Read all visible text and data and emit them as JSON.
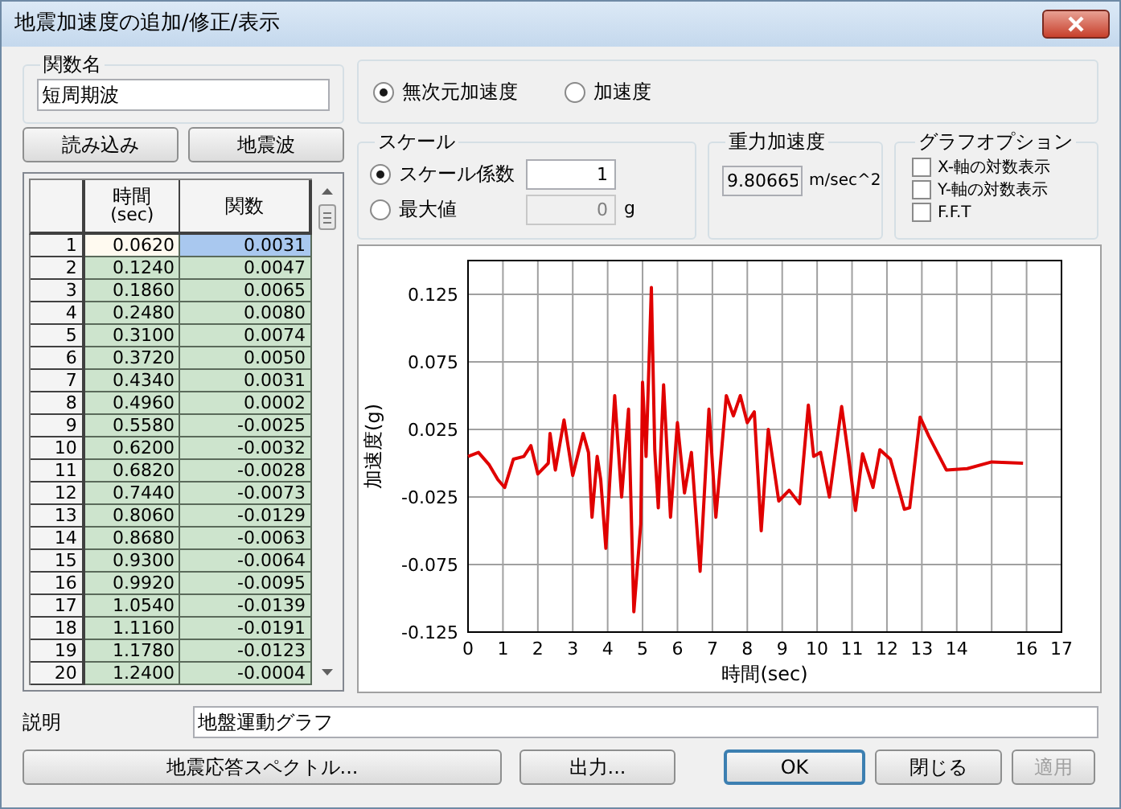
{
  "window": {
    "title": "地震加速度の追加/修正/表示"
  },
  "function_name": {
    "label": "関数名",
    "value": "短周期波"
  },
  "mode_options": [
    {
      "label": "無次元加速度",
      "selected": true
    },
    {
      "label": "加速度",
      "selected": false
    }
  ],
  "load_buttons": [
    "読み込み",
    "地震波"
  ],
  "table": {
    "columns": [
      {
        "label": "時間",
        "unit": "(sec)"
      },
      {
        "label": "関数"
      }
    ],
    "rows": [
      {
        "number": "1",
        "time": "0.0620",
        "value": "0.0031",
        "selected": true
      },
      {
        "number": "2",
        "time": "0.1240",
        "value": "0.0047",
        "selected": false
      },
      {
        "number": "3",
        "time": "0.1860",
        "value": "0.0065",
        "selected": false
      },
      {
        "number": "4",
        "time": "0.2480",
        "value": "0.0080",
        "selected": false
      },
      {
        "number": "5",
        "time": "0.3100",
        "value": "0.0074",
        "selected": false
      },
      {
        "number": "6",
        "time": "0.3720",
        "value": "0.0050",
        "selected": false
      },
      {
        "number": "7",
        "time": "0.4340",
        "value": "0.0031",
        "selected": false
      },
      {
        "number": "8",
        "time": "0.4960",
        "value": "0.0002",
        "selected": false
      },
      {
        "number": "9",
        "time": "0.5580",
        "value": "-0.0025",
        "selected": false
      },
      {
        "number": "10",
        "time": "0.6200",
        "value": "-0.0032",
        "selected": false
      },
      {
        "number": "11",
        "time": "0.6820",
        "value": "-0.0028",
        "selected": false
      },
      {
        "number": "12",
        "time": "0.7440",
        "value": "-0.0073",
        "selected": false
      },
      {
        "number": "13",
        "time": "0.8060",
        "value": "-0.0129",
        "selected": false
      },
      {
        "number": "14",
        "time": "0.8680",
        "value": "-0.0063",
        "selected": false
      },
      {
        "number": "15",
        "time": "0.9300",
        "value": "-0.0064",
        "selected": false
      },
      {
        "number": "16",
        "time": "0.9920",
        "value": "-0.0095",
        "selected": false
      },
      {
        "number": "17",
        "time": "1.0540",
        "value": "-0.0139",
        "selected": false
      },
      {
        "number": "18",
        "time": "1.1160",
        "value": "-0.0191",
        "selected": false
      },
      {
        "number": "19",
        "time": "1.1780",
        "value": "-0.0123",
        "selected": false
      },
      {
        "number": "20",
        "time": "1.2400",
        "value": "-0.0004",
        "selected": false
      }
    ]
  },
  "scale": {
    "title": "スケール",
    "options": [
      {
        "label": "スケール係数",
        "selected": true,
        "value": "1"
      },
      {
        "label": "最大値",
        "selected": false,
        "value": "0",
        "unit": "g"
      }
    ]
  },
  "gravity": {
    "title": "重力加速度",
    "value": "9.80665",
    "unit": "m/sec^2"
  },
  "graph_options": {
    "title": "グラフオプション",
    "items": [
      {
        "label": "X-軸の対数表示",
        "checked": false
      },
      {
        "label": "Y-軸の対数表示",
        "checked": false
      },
      {
        "label": "F.F.T",
        "checked": false
      }
    ]
  },
  "chart": {
    "chart_data": {
      "type": "line",
      "grid": true,
      "xlabel": "時間(sec)",
      "ylabel": "加速度(g)",
      "xlim": [
        0,
        17
      ],
      "ylim": [
        -0.125,
        0.15
      ],
      "xticks": [
        0,
        1,
        2,
        3,
        4,
        5,
        6,
        7,
        8,
        9,
        10,
        11,
        12,
        13,
        14,
        16,
        17
      ],
      "yticks": [
        {
          "value": 0.125,
          "label": "0.125"
        },
        {
          "value": 0.075,
          "label": "0.075"
        },
        {
          "value": 0.025,
          "label": "0.025"
        },
        {
          "value": -0.025,
          "label": "-0.025"
        },
        {
          "value": -0.075,
          "label": "-0.075"
        },
        {
          "value": -0.125,
          "label": "-0.125"
        }
      ],
      "x": [
        0,
        0.3,
        0.6,
        0.85,
        1.05,
        1.3,
        1.6,
        1.8,
        2.0,
        2.3,
        2.35,
        2.5,
        2.75,
        3.0,
        3.3,
        3.45,
        3.55,
        3.7,
        3.8,
        3.95,
        4.2,
        4.4,
        4.6,
        4.75,
        4.95,
        5.0,
        5.1,
        5.25,
        5.35,
        5.45,
        5.6,
        5.8,
        6.0,
        6.2,
        6.4,
        6.65,
        6.9,
        7.1,
        7.4,
        7.6,
        7.8,
        8.0,
        8.2,
        8.4,
        8.6,
        8.9,
        9.2,
        9.5,
        9.75,
        9.9,
        10.1,
        10.35,
        10.7,
        10.9,
        11.1,
        11.3,
        11.6,
        11.8,
        12.1,
        12.5,
        12.65,
        12.95,
        13.2,
        13.7,
        14.3,
        15.0,
        15.9
      ],
      "series": [
        {
          "color": "#e00000",
          "values": [
            0.005,
            0.008,
            -0.001,
            -0.012,
            -0.018,
            0.003,
            0.005,
            0.013,
            -0.008,
            0.0,
            0.022,
            -0.005,
            0.032,
            -0.009,
            0.022,
            0.008,
            -0.04,
            0.005,
            -0.012,
            -0.063,
            0.05,
            -0.025,
            0.04,
            -0.11,
            -0.045,
            0.06,
            0.005,
            0.13,
            0.01,
            -0.033,
            0.058,
            -0.04,
            0.03,
            -0.022,
            0.008,
            -0.08,
            0.04,
            -0.04,
            0.05,
            0.035,
            0.05,
            0.03,
            0.038,
            -0.05,
            0.025,
            -0.028,
            -0.02,
            -0.03,
            0.043,
            0.005,
            0.008,
            -0.025,
            0.042,
            0.005,
            -0.035,
            0.007,
            -0.018,
            0.01,
            0.003,
            -0.034,
            -0.033,
            0.034,
            0.02,
            -0.005,
            -0.004,
            0.001,
            0.0
          ]
        }
      ]
    }
  },
  "description": {
    "label": "説明",
    "value": "地盤運動グラフ"
  },
  "buttons": [
    {
      "label": "地震応答スペクトル...",
      "disabled": false,
      "default": false
    },
    {
      "label": "出力...",
      "disabled": false,
      "default": false
    },
    {
      "label": "OK",
      "disabled": false,
      "default": true
    },
    {
      "label": "閉じる",
      "disabled": false,
      "default": false
    },
    {
      "label": "適用",
      "disabled": true,
      "default": false
    }
  ]
}
